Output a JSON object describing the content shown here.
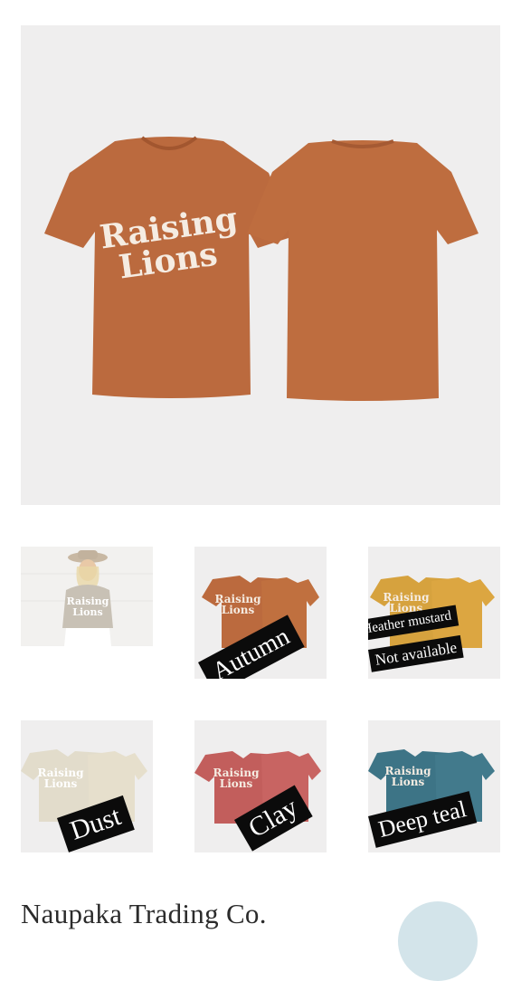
{
  "main_image": {
    "print_line1": "Raising",
    "print_line2": "Lions"
  },
  "thumbnails": [
    {
      "id": "model",
      "label": "",
      "print_line1": "Raising",
      "print_line2": "Lions"
    },
    {
      "id": "autumn",
      "label": "Autumn",
      "color": "#bb6a3e",
      "print_line1": "Raising",
      "print_line2": "Lions"
    },
    {
      "id": "heather-mustard",
      "label": "Heather mustard",
      "sublabel": "Not available",
      "color": "#d6a23e",
      "print_line1": "Raising",
      "print_line2": "Lions"
    },
    {
      "id": "dust",
      "label": "Dust",
      "color": "#e2dccb",
      "print_line1": "Raising",
      "print_line2": "Lions"
    },
    {
      "id": "clay",
      "label": "Clay",
      "color": "#c25e5c",
      "print_line1": "Raising",
      "print_line2": "Lions"
    },
    {
      "id": "deep-teal",
      "label": "Deep teal",
      "color": "#3d7486",
      "print_line1": "Raising",
      "print_line2": "Lions"
    }
  ],
  "brand": {
    "name": "Naupaka Trading Co."
  },
  "colors": {
    "main_shirt": "#bb6a3e",
    "background": "#efeeee",
    "label_bg": "#0b0b0b"
  }
}
